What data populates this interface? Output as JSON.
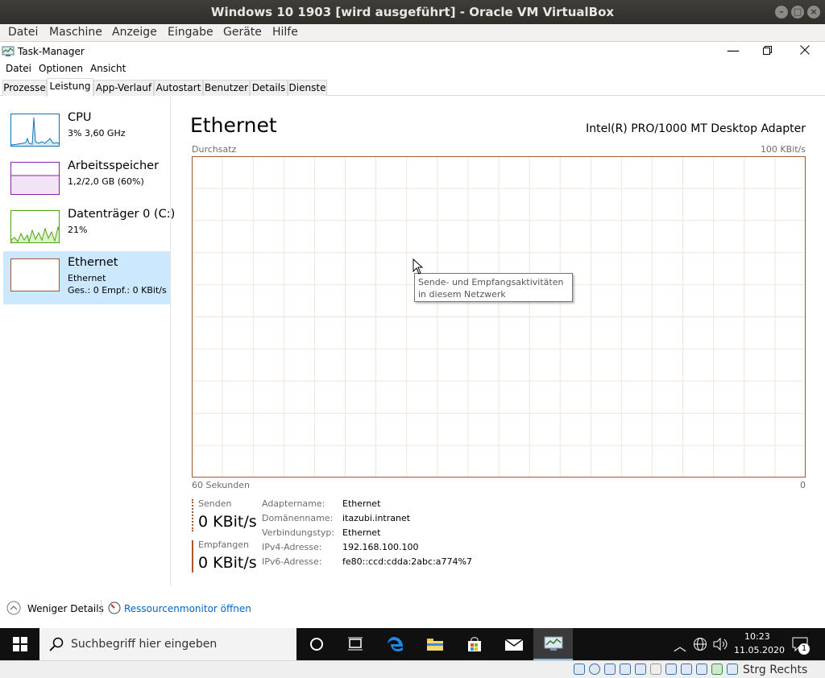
{
  "vbox": {
    "title": "Windows 10 1903 [wird ausgeführt] - Oracle VM VirtualBox",
    "menu": [
      "Datei",
      "Maschine",
      "Anzeige",
      "Eingabe",
      "Geräte",
      "Hilfe"
    ]
  },
  "taskmanager": {
    "title": "Task-Manager",
    "menu": [
      "Datei",
      "Optionen",
      "Ansicht"
    ],
    "tabs": [
      "Prozesse",
      "Leistung",
      "App-Verlauf",
      "Autostart",
      "Benutzer",
      "Details",
      "Dienste"
    ],
    "active_tab": "Leistung"
  },
  "resources": [
    {
      "name": "CPU",
      "sub1": "3% 3,60 GHz",
      "sub2": "",
      "color": "#1173b8"
    },
    {
      "name": "Arbeitsspeicher",
      "sub1": "1,2/2,0 GB (60%)",
      "sub2": "",
      "color": "#8b1fa9"
    },
    {
      "name": "Datenträger 0 (C:)",
      "sub1": "21%",
      "sub2": "",
      "color": "#4da60c"
    },
    {
      "name": "Ethernet",
      "sub1": "Ethernet",
      "sub2": "Ges.: 0 Empf.: 0 KBit/s",
      "color": "#a7572a"
    }
  ],
  "detail": {
    "title": "Ethernet",
    "adapter": "Intel(R) PRO/1000 MT Desktop Adapter",
    "graph_label": "Durchsatz",
    "graph_max": "100 KBit/s",
    "graph_time": "60 Sekunden",
    "graph_min": "0",
    "tooltip": "Sende- und Empfangsaktivitäten in diesem Netzwerk",
    "send_label": "Senden",
    "send_value": "0 KBit/s",
    "recv_label": "Empfangen",
    "recv_value": "0 KBit/s",
    "props": [
      {
        "label": "Adaptername:",
        "value": "Ethernet"
      },
      {
        "label": "Domänenname:",
        "value": "itazubi.intranet"
      },
      {
        "label": "Verbindungstyp:",
        "value": "Ethernet"
      },
      {
        "label": "IPv4-Adresse:",
        "value": "192.168.100.100"
      },
      {
        "label": "IPv6-Adresse:",
        "value": "fe80::ccd:cdda:2abc:a774%7"
      }
    ]
  },
  "footer": {
    "less_details": "Weniger Details",
    "resmon": "Ressourcenmonitor öffnen"
  },
  "taskbar": {
    "search_placeholder": "Suchbegriff hier eingeben",
    "time": "10:23",
    "date": "11.05.2020",
    "notification_count": "1"
  },
  "vbox_status": {
    "hostkey": "Strg Rechts"
  }
}
